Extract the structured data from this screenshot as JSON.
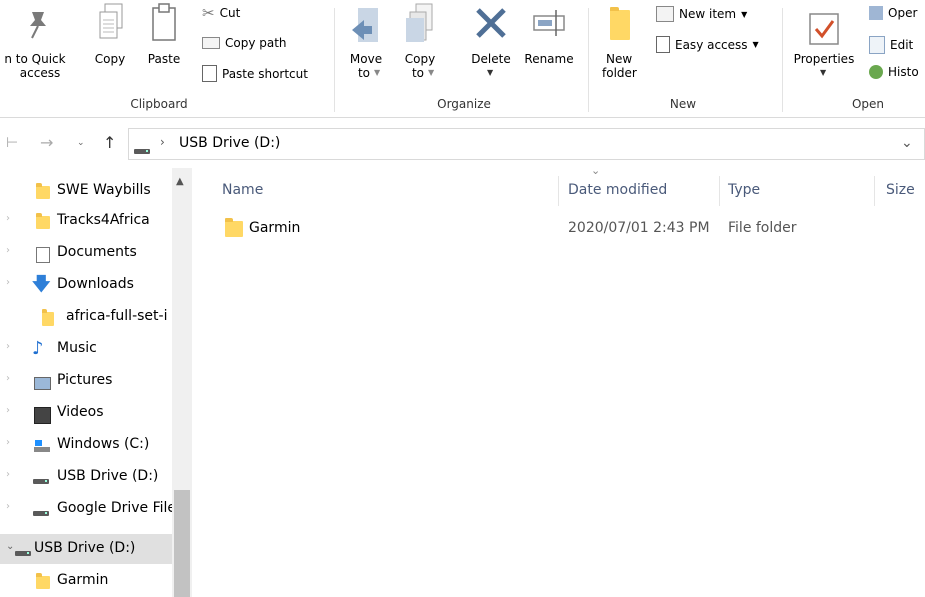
{
  "ribbon": {
    "clipboard": {
      "group_label": "Clipboard",
      "pin_label_line1": "n to Quick",
      "pin_label_line2": "access",
      "copy_label": "Copy",
      "paste_label": "Paste",
      "cut_label": "Cut",
      "copy_path_label": "Copy path",
      "paste_shortcut_label": "Paste shortcut"
    },
    "organize": {
      "group_label": "Organize",
      "move_to_line1": "Move",
      "move_to_line2": "to",
      "copy_to_line1": "Copy",
      "copy_to_line2": "to",
      "delete_label": "Delete",
      "rename_label": "Rename"
    },
    "new": {
      "group_label": "New",
      "new_folder_line1": "New",
      "new_folder_line2": "folder",
      "new_item_label": "New item",
      "easy_access_label": "Easy access"
    },
    "open": {
      "group_label": "Open",
      "properties_label": "Properties",
      "open_label": "Oper",
      "edit_label": "Edit",
      "history_label": "Histo"
    }
  },
  "address": {
    "path": "USB Drive (D:)"
  },
  "nav": {
    "items": [
      {
        "label": "SWE Waybills",
        "icon": "folder-icon"
      },
      {
        "label": "Tracks4Africa",
        "icon": "folder-icon"
      },
      {
        "label": "Documents",
        "icon": "documents-icon"
      },
      {
        "label": "Downloads",
        "icon": "downloads-icon"
      },
      {
        "label": "africa-full-set-i",
        "icon": "zip-folder-icon"
      },
      {
        "label": "Music",
        "icon": "music-icon"
      },
      {
        "label": "Pictures",
        "icon": "pictures-icon"
      },
      {
        "label": "Videos",
        "icon": "videos-icon"
      },
      {
        "label": "Windows (C:)",
        "icon": "windows-drive-icon"
      },
      {
        "label": "USB Drive (D:)",
        "icon": "usb-drive-icon"
      },
      {
        "label": "Google Drive File",
        "icon": "drive-icon"
      },
      {
        "label": "USB Drive (D:)",
        "icon": "usb-drive-icon"
      },
      {
        "label": "Garmin",
        "icon": "folder-icon"
      }
    ]
  },
  "file_list": {
    "columns": {
      "name": "Name",
      "date_modified": "Date modified",
      "type": "Type",
      "size": "Size"
    },
    "rows": [
      {
        "name": "Garmin",
        "date_modified": "2020/07/01 2:43 PM",
        "type": "File folder",
        "size": ""
      }
    ]
  }
}
